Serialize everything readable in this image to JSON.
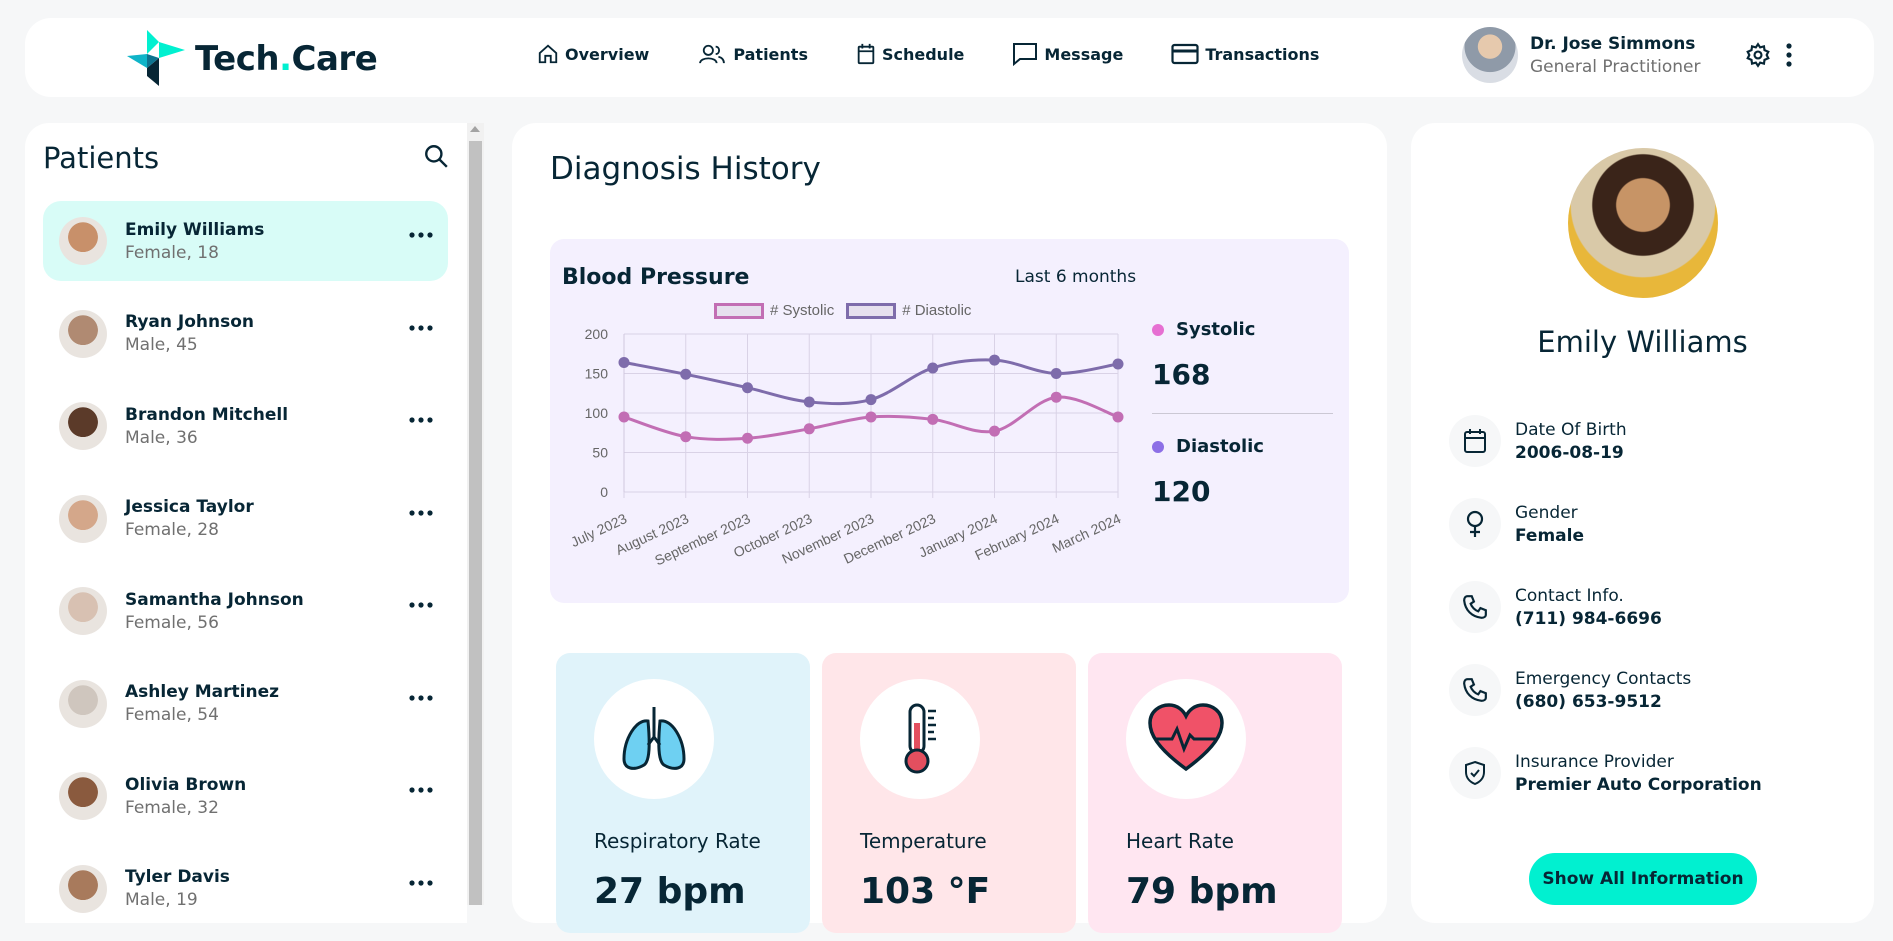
{
  "app": {
    "brand_a": "Tech",
    "brand_dot": ".",
    "brand_b": "Care"
  },
  "nav": [
    {
      "label": "Overview",
      "icon": "home-icon"
    },
    {
      "label": "Patients",
      "icon": "users-icon"
    },
    {
      "label": "Schedule",
      "icon": "calendar-icon"
    },
    {
      "label": "Message",
      "icon": "message-icon"
    },
    {
      "label": "Transactions",
      "icon": "credit-card-icon"
    }
  ],
  "doctor": {
    "name": "Dr. Jose Simmons",
    "role": "General Practitioner"
  },
  "patients": {
    "title": "Patients",
    "list": [
      {
        "name": "Emily Williams",
        "info": "Female, 18",
        "active": true,
        "avatar_color": "#c8906a"
      },
      {
        "name": "Ryan Johnson",
        "info": "Male, 45",
        "active": false,
        "avatar_color": "#b08a72"
      },
      {
        "name": "Brandon Mitchell",
        "info": "Male, 36",
        "active": false,
        "avatar_color": "#5b3a29"
      },
      {
        "name": "Jessica Taylor",
        "info": "Female, 28",
        "active": false,
        "avatar_color": "#d4a78a"
      },
      {
        "name": "Samantha Johnson",
        "info": "Female, 56",
        "active": false,
        "avatar_color": "#d8c1b2"
      },
      {
        "name": "Ashley Martinez",
        "info": "Female, 54",
        "active": false,
        "avatar_color": "#cfc6be"
      },
      {
        "name": "Olivia Brown",
        "info": "Female, 32",
        "active": false,
        "avatar_color": "#8a5a3e"
      },
      {
        "name": "Tyler Davis",
        "info": "Male, 19",
        "active": false,
        "avatar_color": "#a87a5c"
      }
    ]
  },
  "diagnosis": {
    "title": "Diagnosis History",
    "bp_title": "Blood Pressure",
    "range": "Last 6 months",
    "legend_systolic": "# Systolic",
    "legend_diastolic": "# Diastolic",
    "systolic_label": "Systolic",
    "systolic_value": "168",
    "diastolic_label": "Diastolic",
    "diastolic_value": "120"
  },
  "chart_data": {
    "type": "line",
    "x": [
      "July 2023",
      "August 2023",
      "September 2023",
      "October 2023",
      "November 2023",
      "December 2023",
      "January 2024",
      "February 2024",
      "March 2024"
    ],
    "ylim": [
      0,
      200
    ],
    "yticks": [
      0,
      50,
      100,
      150,
      200
    ],
    "series": [
      {
        "name": "# Systolic",
        "color": "#C26EB4",
        "values": [
          95,
          70,
          68,
          80,
          95,
          92,
          77,
          120,
          95
        ]
      },
      {
        "name": "# Diastolic",
        "color": "#7E6CAB",
        "values": [
          164,
          149,
          132,
          114,
          117,
          157,
          167,
          150,
          162
        ]
      }
    ],
    "grid": true,
    "legend": "top"
  },
  "vitals": [
    {
      "label": "Respiratory Rate",
      "value": "27 bpm",
      "bg": "#E0F3FA",
      "icon": "lungs-icon"
    },
    {
      "label": "Temperature",
      "value": "103 °F",
      "bg": "#FFE6E9",
      "icon": "thermometer-icon"
    },
    {
      "label": "Heart Rate",
      "value": "79 bpm",
      "bg": "#FFE6F1",
      "icon": "heart-icon"
    }
  ],
  "profile": {
    "name": "Emily Williams",
    "dob_label": "Date Of Birth",
    "dob": "2006-08-19",
    "gender_label": "Gender",
    "gender": "Female",
    "contact_label": "Contact Info.",
    "contact": "(711) 984-6696",
    "emergency_label": "Emergency Contacts",
    "emergency": "(680) 653-9512",
    "insurance_label": "Insurance Provider",
    "insurance": "Premier Auto Corporation",
    "button": "Show All Information"
  }
}
